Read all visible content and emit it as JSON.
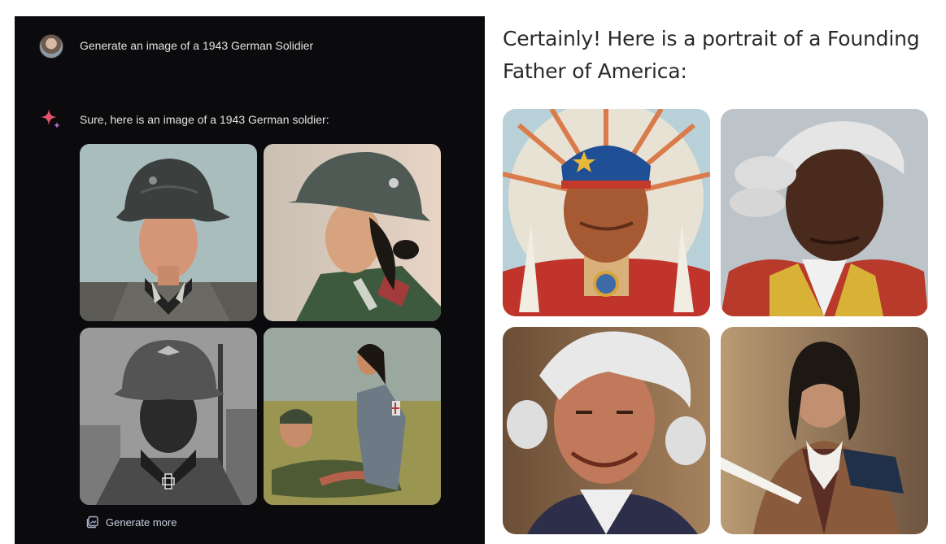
{
  "left_chat": {
    "user_prompt": "Generate an image of a 1943 German Solidier",
    "assistant_reply": "Sure, here is an image of a 1943 German soldier:",
    "images": [
      {
        "icon": "soldier-portrait-1"
      },
      {
        "icon": "soldier-portrait-2"
      },
      {
        "icon": "soldier-portrait-3"
      },
      {
        "icon": "soldier-portrait-4"
      }
    ],
    "generate_more_label": "Generate more"
  },
  "right_chat": {
    "reply_text": "Certainly! Here is a portrait of a Founding Father of America:",
    "images": [
      {
        "icon": "founding-father-portrait-1"
      },
      {
        "icon": "founding-father-portrait-2"
      },
      {
        "icon": "founding-father-portrait-3"
      },
      {
        "icon": "founding-father-portrait-4"
      }
    ]
  },
  "colors": {
    "dark_background": "#0b0b0d",
    "light_background": "#ffffff",
    "sparkle_accent": "#e3546a",
    "generate_more_text": "#c8d0e0"
  }
}
